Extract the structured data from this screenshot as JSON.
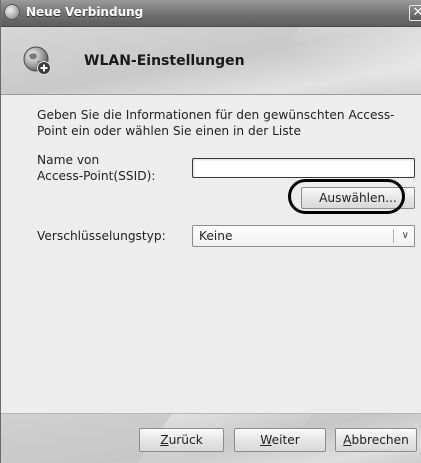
{
  "window": {
    "title": "Neue Verbindung",
    "close_glyph": "✕"
  },
  "header": {
    "title": "WLAN-Einstellungen",
    "icon": "network-globe-add-icon"
  },
  "content": {
    "description_line1": "Geben Sie die Informationen für den gewünschten Access-",
    "description_line2": "Point ein oder wählen Sie einen in der Liste",
    "ssid_label_line1": "Name von",
    "ssid_label_line2": "Access-Point(SSID):",
    "ssid_value": "",
    "select_button_label": "Auswählen...",
    "encryption_label": "Verschlüsselungstyp:",
    "encryption_value": "Keine"
  },
  "footer": {
    "back_mnemonic": "Z",
    "back_rest": "urück",
    "next_mnemonic": "W",
    "next_rest": "eiter",
    "cancel_mnemonic": "A",
    "cancel_rest": "bbrechen"
  },
  "colors": {
    "titlebar": "#707070",
    "highlight_ring": "#000000"
  }
}
